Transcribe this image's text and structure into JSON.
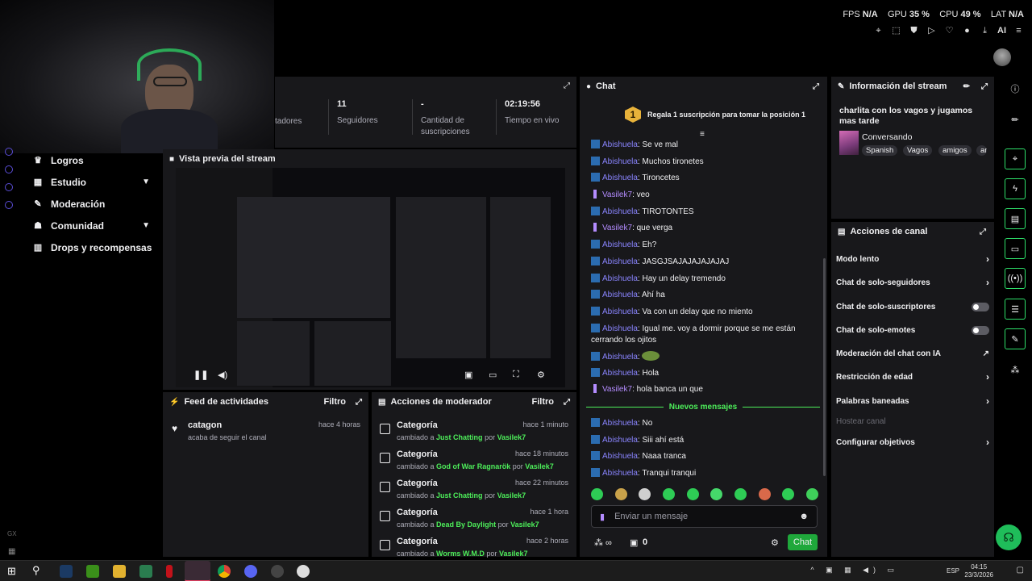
{
  "perf": {
    "fps_label": "FPS",
    "fps": "N/A",
    "gpu_label": "GPU",
    "gpu": "35 %",
    "cpu_label": "CPU",
    "cpu": "49 %",
    "lat_label": "LAT",
    "lat": "N/A"
  },
  "topbar": {
    "ai_label": "AI"
  },
  "nav": [
    {
      "label": "Logros",
      "icon": "trophy-icon"
    },
    {
      "label": "Estudio",
      "icon": "studio-icon",
      "chevron": true
    },
    {
      "label": "Moderación",
      "icon": "wrench-icon"
    },
    {
      "label": "Comunidad",
      "icon": "community-icon",
      "chevron": true
    },
    {
      "label": "Drops y recompensas",
      "icon": "drops-icon"
    }
  ],
  "stats": [
    {
      "value": "",
      "label": "tadores"
    },
    {
      "value": "11",
      "label": "Seguidores"
    },
    {
      "value": "-",
      "label": "Cantidad de suscripciones"
    },
    {
      "value": "02:19:56",
      "label": "Tiempo en vivo"
    }
  ],
  "preview": {
    "title": "Vista previa del stream"
  },
  "activity": {
    "title": "Feed de actividades",
    "filter": "Filtro",
    "items": [
      {
        "name": "catagon",
        "desc": "acaba de seguir el canal",
        "time": "hace 4 horas"
      }
    ]
  },
  "modactions": {
    "title": "Acciones de moderador",
    "filter": "Filtro",
    "items": [
      {
        "title": "Categoría",
        "pre": "cambiado a",
        "cat": "Just Chatting",
        "by": "por",
        "user": "Vasilek7",
        "time": "hace 1 minuto"
      },
      {
        "title": "Categoría",
        "pre": "cambiado a",
        "cat": "God of War Ragnarök",
        "by": "por",
        "user": "Vasilek7",
        "time": "hace 18 minutos"
      },
      {
        "title": "Categoría",
        "pre": "cambiado a",
        "cat": "Just Chatting",
        "by": "por",
        "user": "Vasilek7",
        "time": "hace 22 minutos"
      },
      {
        "title": "Categoría",
        "pre": "cambiado a",
        "cat": "Dead By Daylight",
        "by": "por",
        "user": "Vasilek7",
        "time": "hace 1 hora"
      },
      {
        "title": "Categoría",
        "pre": "cambiado a",
        "cat": "Worms W.M.D",
        "by": "por",
        "user": "Vasilek7",
        "time": "hace 2 horas"
      }
    ]
  },
  "chat": {
    "title": "Chat",
    "pin_rank": "1",
    "pin_text": "Regala 1 suscripción para tomar la posición 1",
    "messages": [
      {
        "user": "Abishuela",
        "type": "a",
        "text": "Se ve mal"
      },
      {
        "user": "Abishuela",
        "type": "a",
        "text": "Muchos tironetes"
      },
      {
        "user": "Abishuela",
        "type": "a",
        "text": "Tironcetes"
      },
      {
        "user": "Vasilek7",
        "type": "v",
        "text": "veo"
      },
      {
        "user": "Abishuela",
        "type": "a",
        "text": "TIROTONTES"
      },
      {
        "user": "Vasilek7",
        "type": "v",
        "text": "que verga"
      },
      {
        "user": "Abishuela",
        "type": "a",
        "text": "Eh?"
      },
      {
        "user": "Abishuela",
        "type": "a",
        "text": "JASGJSAJAJAJAJAJAJ"
      },
      {
        "user": "Abishuela",
        "type": "a",
        "text": "Hay un delay tremendo"
      },
      {
        "user": "Abishuela",
        "type": "a",
        "text": "Ahí ha"
      },
      {
        "user": "Abishuela",
        "type": "a",
        "text": "Va con un delay que no miento"
      },
      {
        "user": "Abishuela",
        "type": "a",
        "text": "Igual me. voy a dormir porque se me están cerrando los ojitos"
      },
      {
        "user": "Abishuela",
        "type": "a",
        "text": ""
      },
      {
        "user": "Abishuela",
        "type": "a",
        "text": "Hola"
      },
      {
        "user": "Vasilek7",
        "type": "v",
        "text": "hola banca un que"
      }
    ],
    "new_label": "Nuevos mensajes",
    "new_messages": [
      {
        "user": "Abishuela",
        "type": "a",
        "text": "No"
      },
      {
        "user": "Abishuela",
        "type": "a",
        "text": "Siii ahí está"
      },
      {
        "user": "Abishuela",
        "type": "a",
        "text": "Naaa tranca"
      },
      {
        "user": "Abishuela",
        "type": "a",
        "text": "Tranqui tranqui"
      }
    ],
    "input_placeholder": "Enviar un mensaje",
    "points": "0",
    "send_label": "Chat"
  },
  "info": {
    "header": "Información del stream",
    "title": "charlita con los vagos y jugamos mas tarde",
    "category": "Conversando",
    "tags": [
      "Spanish",
      "Vagos",
      "amigos",
      "ar"
    ]
  },
  "channel": {
    "header": "Acciones de canal",
    "items": [
      {
        "label": "Modo lento",
        "kind": "arrow"
      },
      {
        "label": "Chat de solo-seguidores",
        "kind": "arrow"
      },
      {
        "label": "Chat de solo-suscriptores",
        "kind": "toggle"
      },
      {
        "label": "Chat de solo-emotes",
        "kind": "toggle"
      },
      {
        "label": "Moderación del chat con IA",
        "kind": "external"
      },
      {
        "label": "Restricción de edad",
        "kind": "arrow"
      },
      {
        "label": "Palabras baneadas",
        "kind": "arrow"
      },
      {
        "label": "Hostear canal",
        "kind": "disabled"
      },
      {
        "label": "Configurar objetivos",
        "kind": "arrow"
      }
    ]
  },
  "taskbar": {
    "lang": "ESP",
    "time": "04:15",
    "date": "23/3/2026"
  },
  "colors": {
    "accent": "#4dee5a",
    "panel": "#18181b",
    "chat_user": "#8a85ff",
    "mod_user": "#b48cff",
    "send": "#1fa83b"
  }
}
